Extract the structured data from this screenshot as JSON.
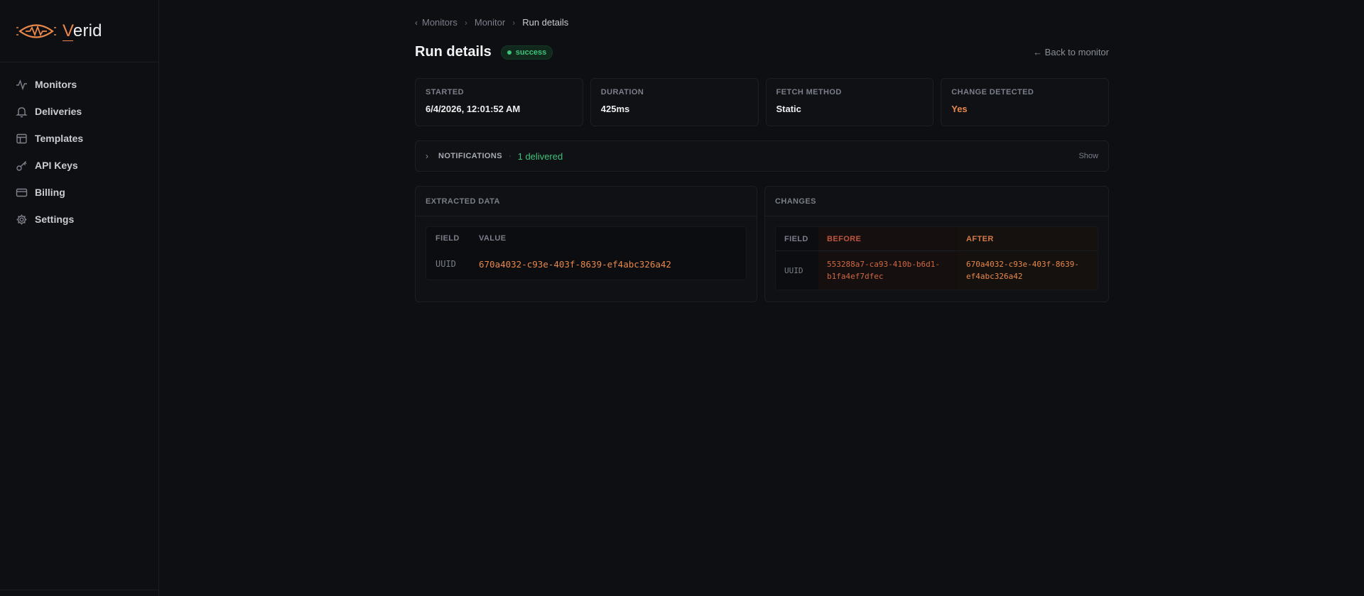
{
  "brand": {
    "initial": "V",
    "rest": "erid"
  },
  "sidebar": {
    "items": [
      {
        "label": "Monitors",
        "icon": "activity-icon"
      },
      {
        "label": "Deliveries",
        "icon": "bell-icon"
      },
      {
        "label": "Templates",
        "icon": "layout-icon"
      },
      {
        "label": "API Keys",
        "icon": "key-icon"
      },
      {
        "label": "Billing",
        "icon": "credit-card-icon"
      },
      {
        "label": "Settings",
        "icon": "gear-icon"
      }
    ]
  },
  "breadcrumb": {
    "items": [
      "Monitors",
      "Monitor",
      "Run details"
    ]
  },
  "header": {
    "title": "Run details",
    "status": "success",
    "back_label": "← Back to monitor"
  },
  "stats": [
    {
      "label": "STARTED",
      "value": "6/4/2026, 12:01:52 AM"
    },
    {
      "label": "DURATION",
      "value": "425ms"
    },
    {
      "label": "FETCH METHOD",
      "value": "Static"
    },
    {
      "label": "CHANGE DETECTED",
      "value": "Yes"
    }
  ],
  "notifications": {
    "label": "NOTIFICATIONS",
    "separator": "·",
    "summary": "1 delivered",
    "toggle": "Show"
  },
  "extracted": {
    "title": "EXTRACTED DATA",
    "columns": [
      "FIELD",
      "VALUE"
    ],
    "rows": [
      {
        "field": "UUID",
        "value": "670a4032-c93e-403f-8639-ef4abc326a42"
      }
    ]
  },
  "changes": {
    "title": "CHANGES",
    "columns": [
      "FIELD",
      "BEFORE",
      "AFTER"
    ],
    "rows": [
      {
        "field": "UUID",
        "before_1": "553288a7-ca93-410b-b6d1-",
        "before_2": "b1fa4ef7dfec",
        "after_1": "670a4032-c93e-403f-8639-",
        "after_2": "ef4abc326a42"
      }
    ]
  },
  "colors": {
    "accent": "#e8884a",
    "success": "#3fc27a",
    "background": "#0d0f13"
  }
}
